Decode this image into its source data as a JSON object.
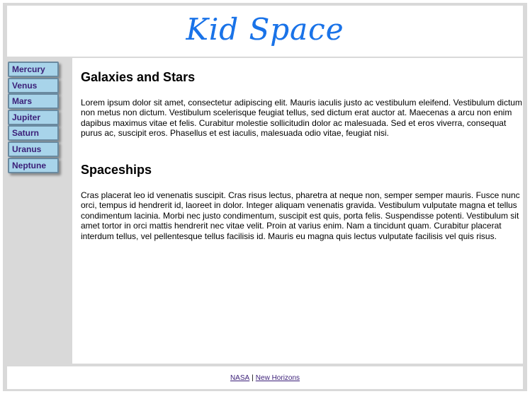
{
  "header": {
    "logo_text": "Kid Space"
  },
  "sidebar": {
    "items": [
      {
        "label": "Mercury"
      },
      {
        "label": "Venus"
      },
      {
        "label": "Mars"
      },
      {
        "label": "Jupiter"
      },
      {
        "label": "Saturn"
      },
      {
        "label": "Uranus"
      },
      {
        "label": "Neptune"
      }
    ]
  },
  "main": {
    "sections": [
      {
        "heading": "Galaxies and Stars",
        "body": "Lorem ipsum dolor sit amet, consectetur adipiscing elit. Mauris iaculis justo ac vestibulum eleifend. Vestibulum dictum non metus non dictum. Vestibulum scelerisque feugiat tellus, sed dictum erat auctor at. Maecenas a arcu non enim dapibus maximus vitae et felis. Curabitur molestie sollicitudin dolor ac malesuada. Sed et eros viverra, consequat purus ac, suscipit eros. Phasellus et est iaculis, malesuada odio vitae, feugiat nisi."
      },
      {
        "heading": "Spaceships",
        "body": "Cras placerat leo id venenatis suscipit. Cras risus lectus, pharetra at neque non, semper semper mauris. Fusce nunc orci, tempus id hendrerit id, laoreet in dolor. Integer aliquam venenatis gravida. Vestibulum vulputate magna et tellus condimentum lacinia. Morbi nec justo condimentum, suscipit est quis, porta felis. Suspendisse potenti. Vestibulum sit amet tortor in orci mattis hendrerit nec vitae velit. Proin at varius enim. Nam a tincidunt quam. Curabitur placerat interdum tellus, vel pellentesque tellus facilisis id. Mauris eu magna quis lectus vulputate facilisis vel quis risus."
      }
    ]
  },
  "footer": {
    "links": [
      {
        "label": "NASA"
      },
      {
        "label": "New Horizons"
      }
    ],
    "separator": "|"
  }
}
